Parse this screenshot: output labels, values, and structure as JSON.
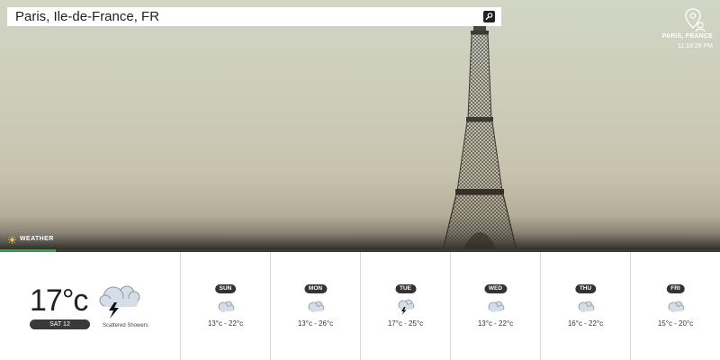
{
  "search": {
    "value": "Paris, Ile-de-France, FR"
  },
  "location": {
    "city": "PARIS, FRANCE",
    "time": "11:19:29 PM"
  },
  "section": {
    "label": "WEATHER",
    "progress": 0.078
  },
  "today": {
    "temperature": "17°c",
    "date": "SAT 12",
    "condition": "Scattered Showers",
    "icon": "thunder-cloud-icon"
  },
  "forecast": [
    {
      "day": "SUN",
      "range": "13°c - 22°c",
      "icon": "cloud-icon"
    },
    {
      "day": "MON",
      "range": "13°c - 26°c",
      "icon": "cloud-icon"
    },
    {
      "day": "TUE",
      "range": "17°c - 25°c",
      "icon": "thunder-cloud-icon"
    },
    {
      "day": "WED",
      "range": "13°c - 22°c",
      "icon": "cloud-icon"
    },
    {
      "day": "THU",
      "range": "16°c - 22°c",
      "icon": "cloud-icon"
    },
    {
      "day": "FRI",
      "range": "15°c - 20°c",
      "icon": "cloud-icon"
    }
  ],
  "colors": {
    "accent": "#2ea44f",
    "pill": "#333333"
  }
}
